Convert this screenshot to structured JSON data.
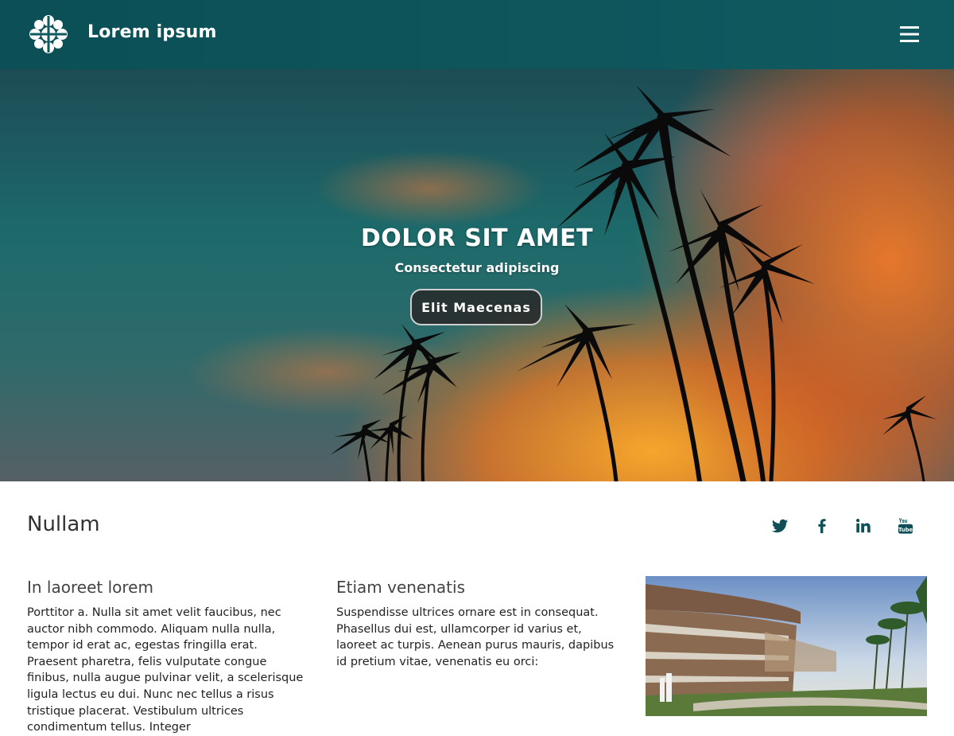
{
  "header": {
    "brand": "Lorem ipsum",
    "logo_icon": "flower-logo-icon",
    "menu_icon": "hamburger-menu-icon",
    "background": "#0f5a60"
  },
  "hero": {
    "title": "DOLOR SIT AMET",
    "subtitle": "Consectetur adipiscing",
    "button_label": "Elit Maecenas"
  },
  "section": {
    "title": "Nullam",
    "social": [
      {
        "icon": "twitter-icon"
      },
      {
        "icon": "facebook-icon"
      },
      {
        "icon": "linkedin-icon"
      },
      {
        "icon": "youtube-icon"
      }
    ]
  },
  "columns": [
    {
      "title": "In laoreet lorem",
      "text": "Porttitor a. Nulla sit amet velit faucibus, nec auctor nibh commodo. Aliquam nulla nulla, tempor id erat ac, egestas fringilla erat. Praesent pharetra, felis vulputate congue finibus, nulla augue pulvinar velit, a scelerisque ligula lectus eu dui. Nunc nec tellus a risus tristique placerat. Vestibulum ultrices condimentum tellus. Integer"
    },
    {
      "title": "Etiam venenatis",
      "text": "Suspendisse ultrices ornare est in consequat. Phasellus dui est, ullamcorper id varius et, laoreet ac turpis. Aenean purus mauris, dapibus id pretium vitae, venenatis eu orci:"
    }
  ],
  "image_alt": "resort-building-photo"
}
